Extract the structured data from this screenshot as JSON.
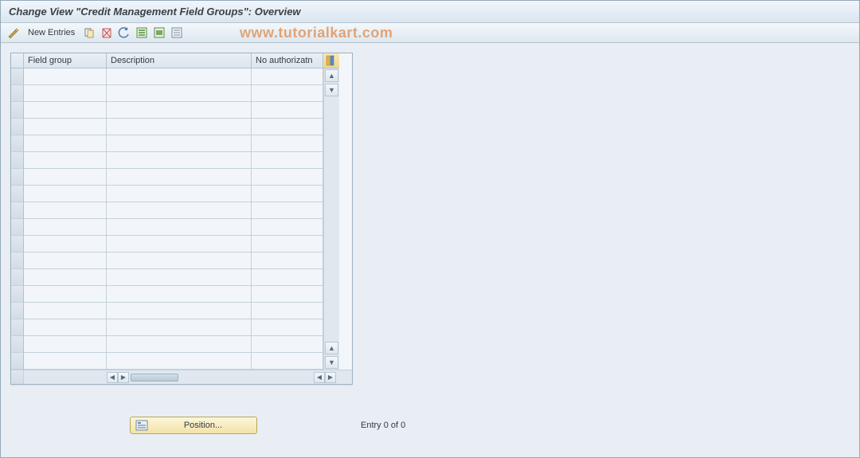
{
  "title": "Change View \"Credit Management Field Groups\": Overview",
  "toolbar": {
    "new_entries_label": "New Entries"
  },
  "watermark": "www.tutorialkart.com",
  "table": {
    "columns": {
      "field_group": "Field group",
      "description": "Description",
      "no_authorizatn": "No authorizatn"
    },
    "row_count": 18
  },
  "footer": {
    "position_label": "Position...",
    "entry_text": "Entry 0 of 0"
  }
}
